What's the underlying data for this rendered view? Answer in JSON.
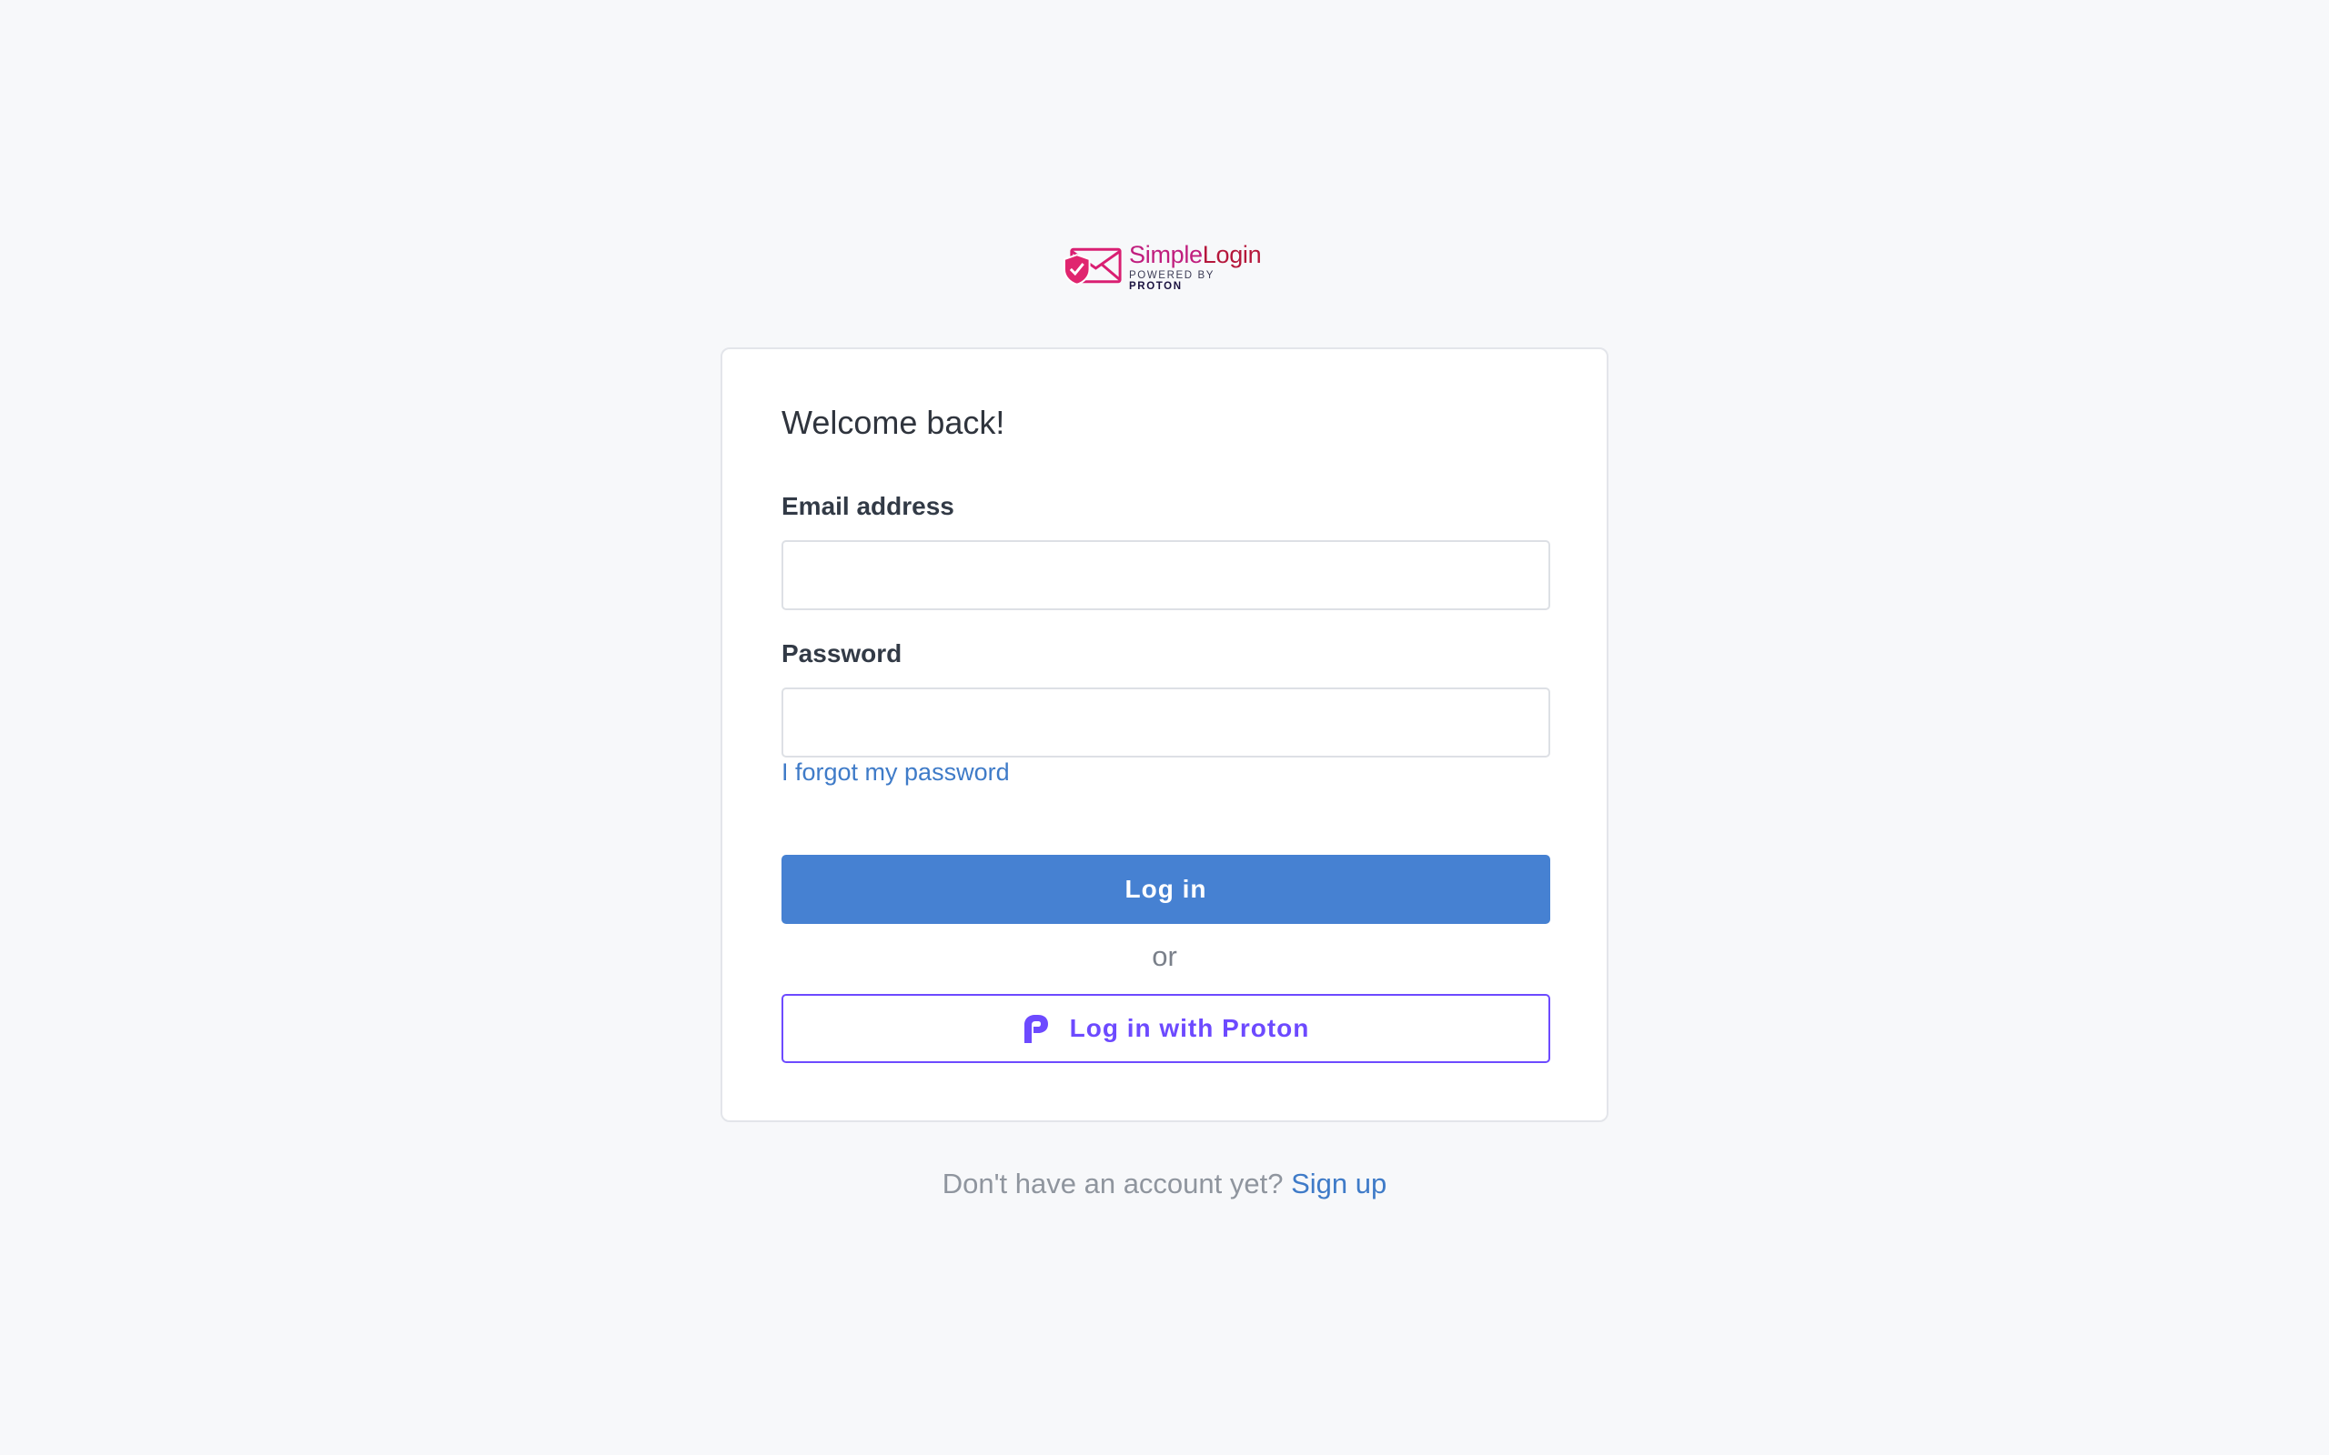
{
  "brand": {
    "name_part1": "Simple",
    "name_part2": "Login",
    "tagline_prefix": "POWERED BY",
    "tagline_brand": "PROTON"
  },
  "card": {
    "title": "Welcome back!",
    "email_label": "Email address",
    "email_value": "",
    "password_label": "Password",
    "password_value": "",
    "forgot_link": "I forgot my password",
    "login_button": "Log in",
    "separator": "or",
    "proton_button": "Log in with Proton"
  },
  "footer": {
    "prompt": "Don't have an account yet?",
    "signup_link": "Sign up"
  },
  "colors": {
    "background": "#f7f8fa",
    "primary": "#4681d2",
    "proton": "#6d4aff",
    "link": "#3f7bc8",
    "brand_pink": "#c01e7e"
  },
  "icons": {
    "logo": "envelope-shield-icon",
    "proton": "proton-p-icon"
  }
}
